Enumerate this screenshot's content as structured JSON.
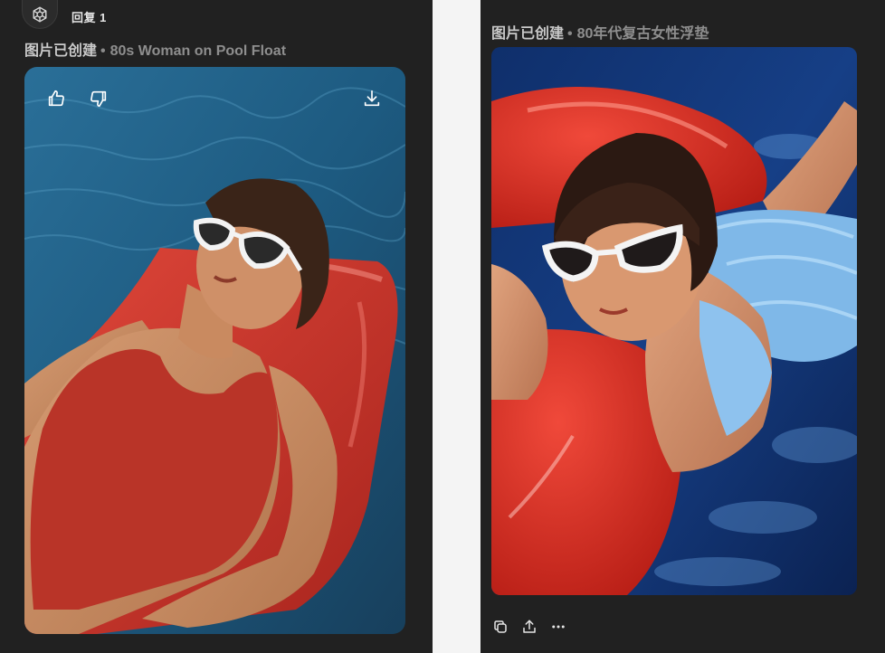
{
  "left": {
    "reply_label": "回复 1",
    "caption": {
      "status": "图片已创建",
      "separator": "•",
      "title": "80s Woman on Pool Float"
    },
    "image": {
      "description_icon": "image-80s-woman-pool-float"
    }
  },
  "right": {
    "caption": {
      "status": "图片已创建",
      "separator": "•",
      "title": "80年代复古女性浮垫"
    },
    "image": {
      "description_icon": "image-80s-retro-woman-float"
    }
  },
  "icons": {
    "avatar": "openai-logo-icon",
    "like": "thumbs-up-icon",
    "dislike": "thumbs-down-icon",
    "download": "download-icon",
    "copy": "copy-icon",
    "share": "share-icon",
    "more": "more-horizontal-icon"
  },
  "colors": {
    "panel_bg": "#212121",
    "page_bg": "#f4f4f4",
    "pool_blue": "#1d5f86",
    "float_red": "#c8342a",
    "icon_white": "#ffffff"
  }
}
